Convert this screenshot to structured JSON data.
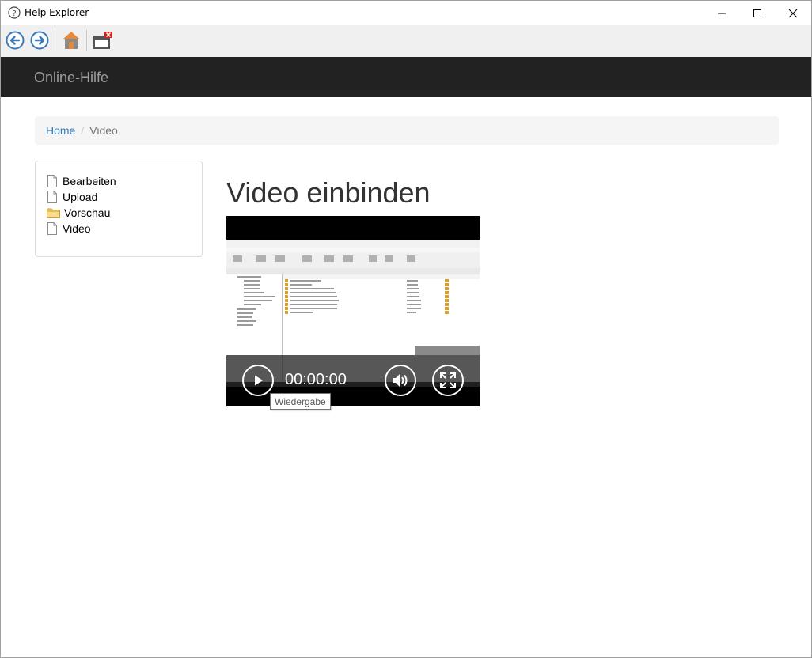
{
  "window": {
    "title": "Help Explorer"
  },
  "navbar": {
    "brand": "Online-Hilfe"
  },
  "breadcrumb": {
    "home": "Home",
    "separator": "/",
    "current": "Video"
  },
  "sidebar": {
    "items": [
      {
        "label": "Bearbeiten",
        "icon": "document-icon"
      },
      {
        "label": "Upload",
        "icon": "document-icon"
      },
      {
        "label": "Vorschau",
        "icon": "folder-icon"
      },
      {
        "label": "Video",
        "icon": "document-icon"
      }
    ]
  },
  "main": {
    "title": "Video einbinden"
  },
  "video": {
    "time": "00:00:00",
    "tooltip": "Wiedergabe"
  },
  "colors": {
    "navbar": "#222222",
    "link": "#337ab7",
    "toolbar": "#f0f0f0",
    "nav_arrow": "#3a79b8"
  }
}
